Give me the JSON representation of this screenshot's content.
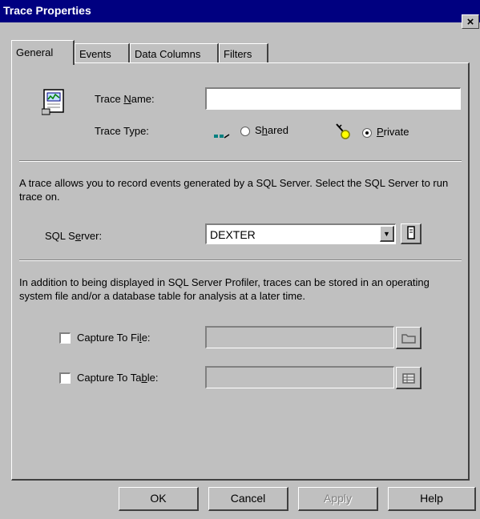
{
  "window": {
    "title": "Trace Properties",
    "close_glyph": "×"
  },
  "tabs": [
    {
      "label": "General",
      "active": true
    },
    {
      "label": "Events",
      "active": false
    },
    {
      "label": "Data Columns",
      "active": false
    },
    {
      "label": "Filters",
      "active": false
    }
  ],
  "general": {
    "icon": "trace-properties-icon",
    "trace_name": {
      "label_pre": "Trace ",
      "label_access": "N",
      "label_post": "ame:",
      "value": ""
    },
    "trace_type": {
      "label": "Trace Type:",
      "shared": {
        "pre": "S",
        "access": "h",
        "post": "ared",
        "selected": false,
        "icon": "shared-icon"
      },
      "private": {
        "pre": "",
        "access": "P",
        "post": "rivate",
        "selected": true,
        "icon": "private-key-icon"
      }
    },
    "server_description": "A trace allows you to record events generated by a SQL Server. Select the SQL Server to run trace on.",
    "sql_server": {
      "label_pre": "SQL S",
      "label_access": "e",
      "label_post": "rver:",
      "value": "DEXTER",
      "dropdown_glyph": "▼",
      "icon": "server-icon"
    },
    "storage_description": "In addition to being displayed in SQL Server Profiler, traces can be stored in an operating system file and/or a database table for analysis at a later time.",
    "capture_file": {
      "label_pre": "Capture To Fi",
      "label_access": "l",
      "label_post": "e:",
      "checked": false,
      "value": "",
      "icon": "folder-icon"
    },
    "capture_table": {
      "label_pre": "Capture To Ta",
      "label_access": "b",
      "label_post": "le:",
      "checked": false,
      "value": "",
      "icon": "table-icon"
    }
  },
  "buttons": {
    "ok": "OK",
    "cancel": "Cancel",
    "apply": "Apply",
    "help": "Help"
  },
  "colors": {
    "title_bar": "#000080",
    "face": "#c0c0c0"
  }
}
